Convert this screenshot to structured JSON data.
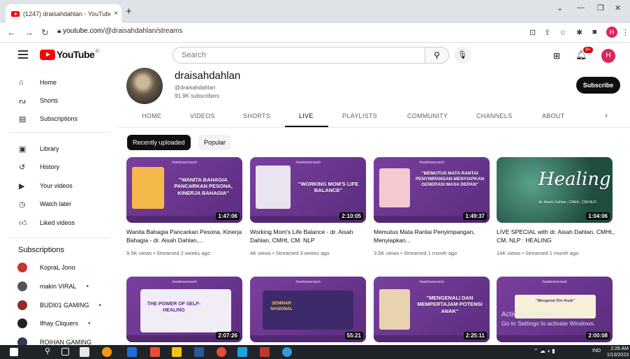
{
  "browser": {
    "tab_title": "(1247) draisahdahlan - YouTube",
    "tab_close": "×",
    "new_tab": "+",
    "url_domain": "youtube.com",
    "url_path": "/@draisahdahlan/streams",
    "profile_initial": "H"
  },
  "header": {
    "logo_word": "YouTube",
    "logo_sup": "ID",
    "search_placeholder": "Search",
    "notif_count": "9+",
    "avatar_initial": "H"
  },
  "sidebar": {
    "items": [
      {
        "label": "Home",
        "icon": "home-icon"
      },
      {
        "label": "Shorts",
        "icon": "shorts-icon"
      },
      {
        "label": "Subscriptions",
        "icon": "subscriptions-icon"
      },
      {
        "label": "Library",
        "icon": "library-icon"
      },
      {
        "label": "History",
        "icon": "history-icon"
      },
      {
        "label": "Your videos",
        "icon": "your-videos-icon"
      },
      {
        "label": "Watch later",
        "icon": "watch-later-icon"
      },
      {
        "label": "Liked videos",
        "icon": "liked-videos-icon"
      }
    ],
    "subscriptions_title": "Subscriptions",
    "subscriptions": [
      {
        "name": "KopraL Jono",
        "color": "#c0392b",
        "dot": ""
      },
      {
        "name": "makin VIRAL",
        "color": "#555555",
        "dot": "•"
      },
      {
        "name": "BUDI01 GAMING",
        "color": "#8e2b2b",
        "dot": "•"
      },
      {
        "name": "Ifhay Cliquers",
        "color": "#222222",
        "dot": "•"
      },
      {
        "name": "ROIHAN GAMING",
        "color": "#2c3e50",
        "dot": ""
      }
    ]
  },
  "channel": {
    "name": "draisahdahlan",
    "handle": "@draisahdahlan",
    "subscribers": "91.9K subscribers",
    "subscribe_label": "Subscribe"
  },
  "tabs": [
    "HOME",
    "VIDEOS",
    "SHORTS",
    "LIVE",
    "PLAYLISTS",
    "COMMUNITY",
    "CHANNELS",
    "ABOUT"
  ],
  "active_tab": "LIVE",
  "chips": {
    "recent": "Recently uploaded",
    "popular": "Popular"
  },
  "videos": [
    {
      "caption": "\"WANITA BAHAGIA PANCARKAN PESONA, KINERJA BAHAGIA\"",
      "duration": "1:47:06",
      "title": "Wanita Bahagia Pancarkan Pesona, Kinerja Bahagia - dr. Aisah Dahlan,...",
      "meta": "9.5K views • Streamed 2 weeks ago"
    },
    {
      "caption": "\"WORKING MOM'S LIFE BALANCE\"",
      "duration": "2:10:05",
      "title": "Working Mom's Life Balance - dr. Aisah Dahlan, CMHt, CM. NLP",
      "meta": "4K views • Streamed 3 weeks ago"
    },
    {
      "caption": "\"MEMUTUS MATA RANTAI PENYIMPANGAN MENYIAPKAN GENERASI MASA DEPAN\"",
      "duration": "1:49:37",
      "title": "Memutus Mata Rantai Penyimpangan, Menyiapkan...",
      "meta": "3.5K views • Streamed 1 month ago"
    },
    {
      "caption": "Healing",
      "sub": "dr. Aisah Dahlan, CMHt., CM.NLP.",
      "duration": "1:04:06",
      "title": "LIVE SPECIAL with dr. Aisah Dahlan, CMHt., CM. NLP : HEALING",
      "meta": "14K views • Streamed 1 month ago"
    },
    {
      "caption": "THE POWER OF SELF-HEALING",
      "duration": "2:07:26"
    },
    {
      "caption": "SEMINAR NASIONAL",
      "duration": "55:21"
    },
    {
      "caption": "\"MENGENALI DAN MEMPERTAJAM POTENSI ANAK\"",
      "duration": "2:25:11"
    },
    {
      "caption": "\"Mengenal Diri Anak\"",
      "duration": "2:00:08"
    }
  ],
  "webinar_tag": "#webinarorasoh",
  "activation": {
    "line1": "Activate Windows",
    "line2": "Go to Settings to activate Windows."
  },
  "taskbar": {
    "lang": "IND",
    "time": "2:26 AM",
    "date": "1/10/2023"
  },
  "colors": {
    "accent": "#ff0000",
    "thumb_purple": "#6d3b8f",
    "thumb_green": "#2f6b5a"
  }
}
